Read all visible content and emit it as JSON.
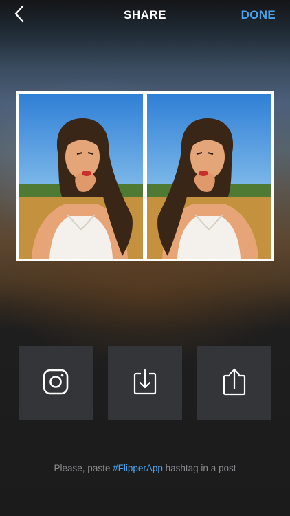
{
  "navbar": {
    "back_icon": "chevron-left-icon",
    "title": "SHARE",
    "done_label": "DONE"
  },
  "preview": {
    "layout": "mirrored-duplicate",
    "frame_color": "#ffffff"
  },
  "actions": [
    {
      "id": "instagram",
      "icon": "instagram-icon"
    },
    {
      "id": "save",
      "icon": "download-icon"
    },
    {
      "id": "share",
      "icon": "share-icon"
    }
  ],
  "hint": {
    "prefix": "Please, paste ",
    "hashtag": "#FlipperApp",
    "suffix": " hashtag in a post"
  },
  "colors": {
    "accent": "#4aa3ea",
    "button_bg": "#343539",
    "hint_text": "#8a8a8e"
  }
}
